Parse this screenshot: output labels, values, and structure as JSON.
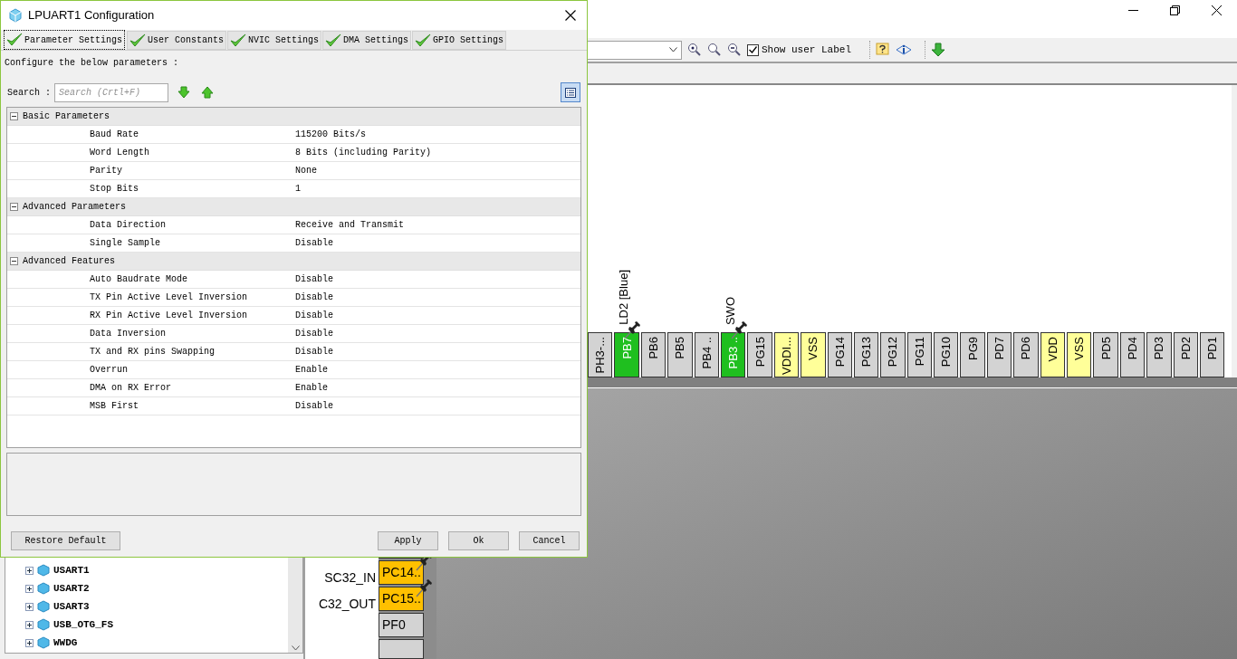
{
  "dialog": {
    "title": "LPUART1 Configuration",
    "tabs": [
      {
        "label": "Parameter Settings",
        "selected": true
      },
      {
        "label": "User Constants",
        "selected": false
      },
      {
        "label": "NVIC Settings",
        "selected": false
      },
      {
        "label": "DMA Settings",
        "selected": false
      },
      {
        "label": "GPIO Settings",
        "selected": false
      }
    ],
    "instruction": "Configure the below parameters :",
    "search": {
      "label": "Search :",
      "placeholder": "Search (Crtl+F)"
    },
    "sections": [
      {
        "title": "Basic Parameters",
        "expanded": true,
        "rows": [
          {
            "name": "Baud Rate",
            "value": "115200 Bits/s"
          },
          {
            "name": "Word Length",
            "value": "8 Bits (including Parity)"
          },
          {
            "name": "Parity",
            "value": "None"
          },
          {
            "name": "Stop Bits",
            "value": "1"
          }
        ]
      },
      {
        "title": "Advanced Parameters",
        "expanded": true,
        "rows": [
          {
            "name": "Data Direction",
            "value": "Receive and Transmit"
          },
          {
            "name": "Single Sample",
            "value": "Disable"
          }
        ]
      },
      {
        "title": "Advanced Features",
        "expanded": true,
        "rows": [
          {
            "name": "Auto Baudrate Mode",
            "value": "Disable"
          },
          {
            "name": "TX Pin Active Level Inversion",
            "value": "Disable"
          },
          {
            "name": "RX Pin Active Level Inversion",
            "value": "Disable"
          },
          {
            "name": "Data Inversion",
            "value": "Disable"
          },
          {
            "name": "TX and RX pins Swapping",
            "value": "Disable"
          },
          {
            "name": "Overrun",
            "value": "Enable"
          },
          {
            "name": "DMA on RX Error",
            "value": "Enable"
          },
          {
            "name": "MSB First",
            "value": "Disable"
          }
        ]
      }
    ],
    "buttons": {
      "restore": "Restore Default",
      "apply": "Apply",
      "ok": "Ok",
      "cancel": "Cancel"
    }
  },
  "toolbar": {
    "show_user_label": {
      "label": "Show user Label",
      "checked": true
    }
  },
  "top_pins": [
    {
      "label": "PH3-...",
      "color": "#d3d3d3",
      "pinned": false
    },
    {
      "label": "PB7",
      "color": "#1fbf1f",
      "pinned": true,
      "signal": "LD2 [Blue]"
    },
    {
      "label": "PB6",
      "color": "#d3d3d3",
      "pinned": false
    },
    {
      "label": "PB5",
      "color": "#d3d3d3",
      "pinned": false
    },
    {
      "label": "PB4 ..",
      "color": "#d3d3d3",
      "pinned": false
    },
    {
      "label": "PB3 ..",
      "color": "#1fbf1f",
      "pinned": true,
      "signal": "SWO"
    },
    {
      "label": "PG15",
      "color": "#d3d3d3",
      "pinned": false
    },
    {
      "label": "VDDI...",
      "color": "#ffff99",
      "pinned": false
    },
    {
      "label": "VSS",
      "color": "#ffff99",
      "pinned": false
    },
    {
      "label": "PG14",
      "color": "#d3d3d3",
      "pinned": false
    },
    {
      "label": "PG13",
      "color": "#d3d3d3",
      "pinned": false
    },
    {
      "label": "PG12",
      "color": "#d3d3d3",
      "pinned": false
    },
    {
      "label": "PG11",
      "color": "#d3d3d3",
      "pinned": false
    },
    {
      "label": "PG10",
      "color": "#d3d3d3",
      "pinned": false
    },
    {
      "label": "PG9",
      "color": "#d3d3d3",
      "pinned": false
    },
    {
      "label": "PD7",
      "color": "#d3d3d3",
      "pinned": false
    },
    {
      "label": "PD6",
      "color": "#d3d3d3",
      "pinned": false
    },
    {
      "label": "VDD",
      "color": "#ffff99",
      "pinned": false
    },
    {
      "label": "VSS",
      "color": "#ffff99",
      "pinned": false
    },
    {
      "label": "PD5",
      "color": "#d3d3d3",
      "pinned": false
    },
    {
      "label": "PD4",
      "color": "#d3d3d3",
      "pinned": false
    },
    {
      "label": "PD3",
      "color": "#d3d3d3",
      "pinned": false
    },
    {
      "label": "PD2",
      "color": "#d3d3d3",
      "pinned": false
    },
    {
      "label": "PD1",
      "color": "#d3d3d3",
      "pinned": false
    }
  ],
  "left_pins": [
    {
      "label": "PC14..",
      "color": "#ffc000",
      "pinned": true,
      "signal": "SC32_IN"
    },
    {
      "label": "PC15..",
      "color": "#ffc000",
      "pinned": true,
      "signal": "C32_OUT"
    },
    {
      "label": "PF0",
      "color": "#d3d3d3",
      "pinned": false
    }
  ],
  "tree": [
    {
      "label": "USART1",
      "expanded": false
    },
    {
      "label": "USART2",
      "expanded": false
    },
    {
      "label": "USART3",
      "expanded": false
    },
    {
      "label": "USB_OTG_FS",
      "expanded": false
    },
    {
      "label": "WWDG",
      "expanded": false
    }
  ]
}
